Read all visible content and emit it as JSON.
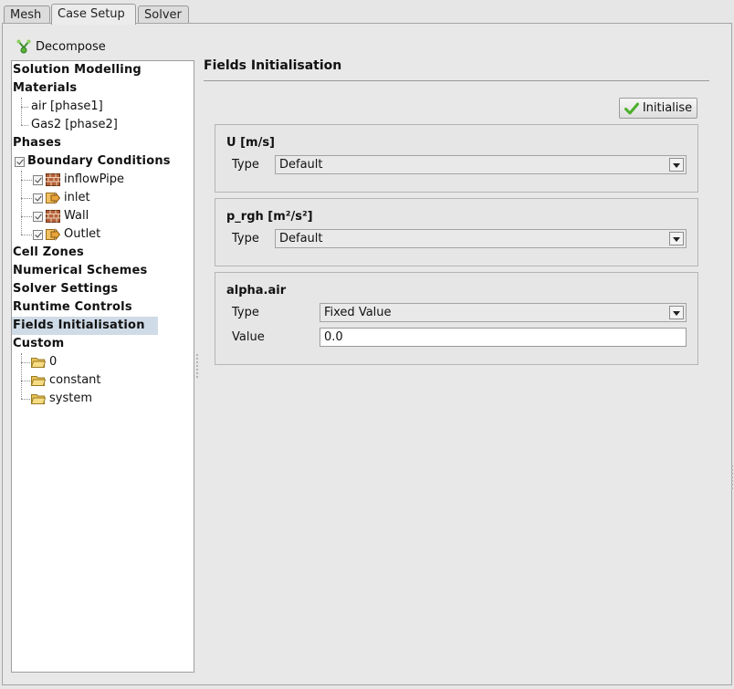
{
  "tabs": [
    {
      "label": "Mesh"
    },
    {
      "label": "Case Setup"
    },
    {
      "label": "Solver"
    }
  ],
  "toolbar": {
    "decompose_label": "Decompose"
  },
  "tree": {
    "solution_modelling": "Solution Modelling",
    "materials": "Materials",
    "material_items": [
      "air [phase1]",
      "Gas2 [phase2]"
    ],
    "phases": "Phases",
    "boundary_conditions": "Boundary Conditions",
    "boundaries": [
      {
        "label": "inflowPipe",
        "icon": "wall-icon"
      },
      {
        "label": "inlet",
        "icon": "patch-icon"
      },
      {
        "label": "Wall",
        "icon": "wall-icon"
      },
      {
        "label": "Outlet",
        "icon": "patch-icon"
      }
    ],
    "cell_zones": "Cell Zones",
    "numerical_schemes": "Numerical Schemes",
    "solver_settings": "Solver Settings",
    "runtime_controls": "Runtime Controls",
    "fields_initialisation": "Fields Initialisation",
    "custom": "Custom",
    "custom_items": [
      "0",
      "constant",
      "system"
    ]
  },
  "main": {
    "title": "Fields Initialisation",
    "initialise_label": "Initialise",
    "fields": [
      {
        "name": "U [m/s]",
        "type_label": "Type",
        "type_value": "Default"
      },
      {
        "name": "p_rgh [m²/s²]",
        "type_label": "Type",
        "type_value": "Default"
      },
      {
        "name": "alpha.air",
        "type_label": "Type",
        "type_value": "Fixed Value",
        "value_label": "Value",
        "value": "0.0"
      }
    ]
  },
  "colors": {
    "selection": "#cfdbe6",
    "check_green": "#4caf2a",
    "wall_brown": "#a0522d",
    "patch_orange": "#e8a33a",
    "folder_yellow": "#e9c35b"
  }
}
